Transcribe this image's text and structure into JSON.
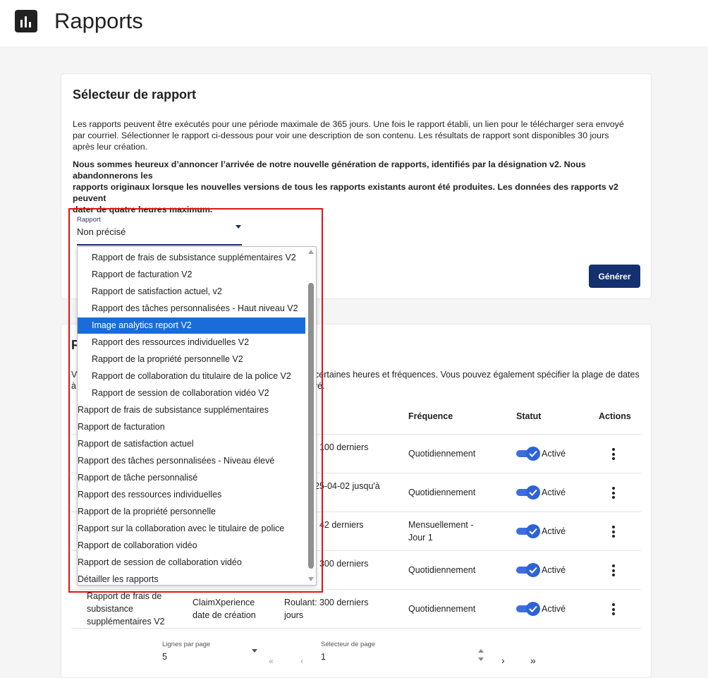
{
  "app": {
    "title": "Rapports",
    "logo_icon": "bar-chart-icon"
  },
  "selector_card": {
    "title": "Sélecteur de rapport",
    "description_lines": [
      "Les rapports peuvent être exécutés pour une période maximale de 365 jours. Une fois le rapport établi, un lien pour le télécharger sera envoyé",
      "par courriel. Sélectionner le rapport ci-dessous pour voir une description de son contenu. Les résultats de rapport sont disponibles 30 jours",
      "après leur création."
    ],
    "announcement_lines": [
      "Nous sommes heureux d’annoncer l’arrivée de notre nouvelle génération de rapports, identifiés par la désignation v2. Nous abandonnerons les",
      "rapports originaux lorsque les nouvelles versions de tous les rapports existants auront été produites. Les données des rapports v2 peuvent",
      "dater de quatre heures maximum."
    ],
    "select": {
      "label": "Rapport",
      "value": "Non précisé"
    },
    "generate_button": "Générer"
  },
  "dropdown": {
    "selected_index": 4,
    "items": [
      {
        "label": "Rapport de frais de subsistance supplémentaires V2",
        "indent": true
      },
      {
        "label": "Rapport de facturation V2",
        "indent": true
      },
      {
        "label": "Rapport de satisfaction actuel, v2",
        "indent": true
      },
      {
        "label": "Rapport des tâches personnalisées - Haut niveau V2",
        "indent": true
      },
      {
        "label": "Image analytics report V2",
        "indent": true
      },
      {
        "label": "Rapport des ressources individuelles V2",
        "indent": true
      },
      {
        "label": "Rapport de la propriété personnelle V2",
        "indent": true
      },
      {
        "label": "Rapport de collaboration du titulaire de la police V2",
        "indent": true
      },
      {
        "label": "Rapport de session de collaboration vidéo V2",
        "indent": true
      },
      {
        "label": "Rapport de frais de subsistance supplémentaires",
        "indent": false
      },
      {
        "label": "Rapport de facturation",
        "indent": false
      },
      {
        "label": "Rapport de satisfaction actuel",
        "indent": false
      },
      {
        "label": "Rapport des tâches personnalisées - Niveau élevé",
        "indent": false
      },
      {
        "label": "Rapport de tâche personnalisé",
        "indent": false
      },
      {
        "label": "Rapport des ressources individuelles",
        "indent": false
      },
      {
        "label": "Rapport de la propriété personnelle",
        "indent": false
      },
      {
        "label": "Rapport sur la collaboration avec le titulaire de police",
        "indent": false
      },
      {
        "label": "Rapport de collaboration vidéo",
        "indent": false
      },
      {
        "label": "Rapport de session de collaboration vidéo",
        "indent": false
      },
      {
        "label": "Détailler les rapports",
        "indent": false
      }
    ]
  },
  "schedule_card": {
    "title_partial": "F",
    "desc_left_1": "V",
    "desc_left_2": "à",
    "desc_right_1": "certaines heures et fréquences. Vous pouvez également spécifier la plage de dates",
    "desc_right_2": "ré.",
    "headers": {
      "frequency": "Fréquence",
      "status": "Statut",
      "actions": "Actions"
    },
    "rows": [
      {
        "range": ": 100 derniers",
        "frequency": "Quotidiennement",
        "status": "Activé"
      },
      {
        "range": "25-04-02 jusqu'à",
        "frequency": "Quotidiennement",
        "status": "Activé"
      },
      {
        "range": ": 42 derniers",
        "frequency": "Mensuellement -",
        "frequency2": "Jour 1",
        "status": "Activé"
      },
      {
        "range": ": 300 derniers",
        "frequency": "Quotidiennement",
        "status": "Activé"
      },
      {
        "report_1": "Rapport de frais de",
        "report_2": "subsistance",
        "report_3": "supplémentaires V2",
        "source_1": "ClaimXperience",
        "source_2": "date de création",
        "range": "Roulant: 300 derniers",
        "range_2": "jours",
        "frequency": "Quotidiennement",
        "status": "Activé"
      }
    ],
    "pagination": {
      "rows_label": "Lignes par page",
      "rows_value": "5",
      "page_label": "Sélecteur de page",
      "page_value": "1"
    }
  },
  "colors": {
    "primary": "#15306e",
    "selected": "#1a6dd8",
    "toggle": "#2e63d6",
    "highlight": "#e01414"
  }
}
